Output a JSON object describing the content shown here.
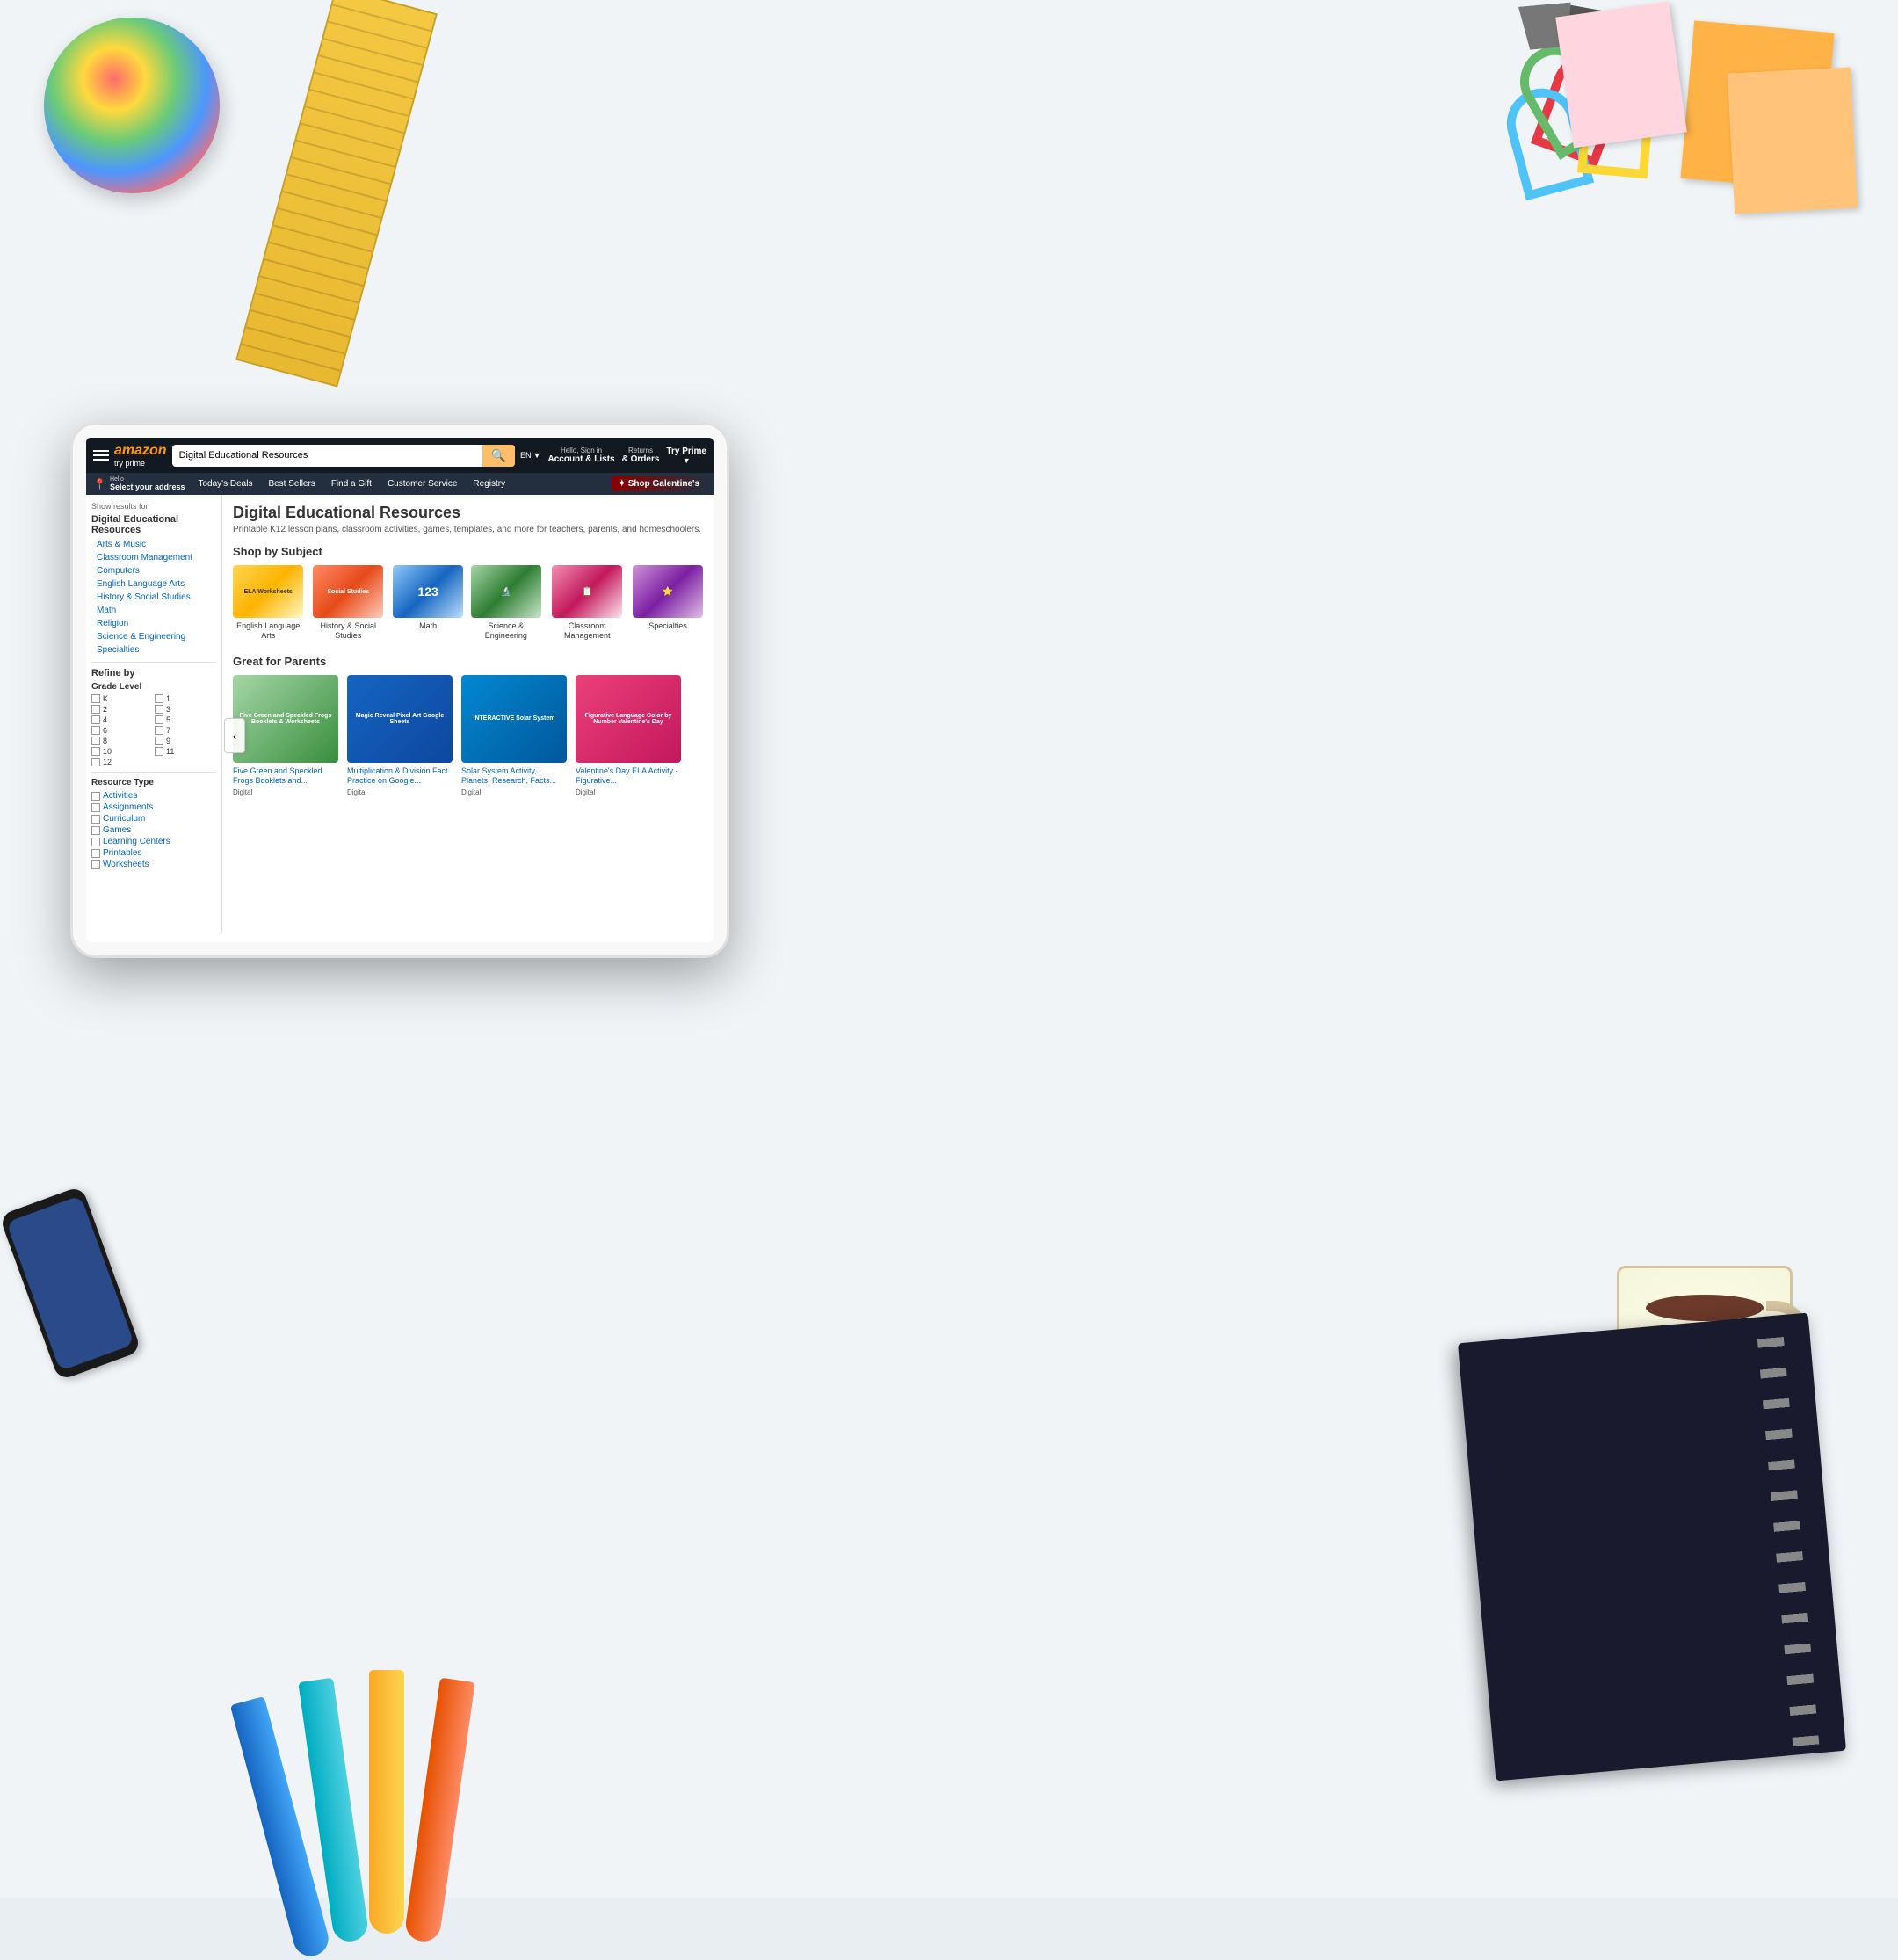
{
  "scene": {
    "background_color": "#e8eef2"
  },
  "amazon": {
    "logo": "amazon",
    "logo_sub": "try prime",
    "search_placeholder": "Digital Educational Resources",
    "search_value": "Digital Educational Resources",
    "nav": {
      "language": "EN",
      "hello": "Hello, Sign in",
      "account_lists": "Account & Lists",
      "returns": "Returns",
      "orders": "& Orders",
      "try_prime": "Try Prime"
    },
    "address_bar": {
      "hello": "Hello",
      "select_address": "Select your address"
    },
    "subnav": [
      "Today's Deals",
      "Best Sellers",
      "Find a Gift",
      "Customer Service",
      "Registry"
    ],
    "galentine_promo": "✦ Shop Galentine's",
    "sidebar": {
      "show_results_for": "Show results for",
      "category_header": "Digital Educational Resources",
      "items": [
        "Arts & Music",
        "Classroom Management",
        "Computers",
        "English Language Arts",
        "History & Social Studies",
        "Math",
        "Religion",
        "Science & Engineering",
        "Specialties"
      ],
      "refine_by": "Refine by",
      "grade_level": "Grade Level",
      "grades": [
        "K",
        "1",
        "2",
        "3",
        "4",
        "5",
        "6",
        "7",
        "8",
        "9",
        "10",
        "11",
        "12"
      ],
      "resource_type": "Resource Type",
      "resource_types": [
        "Activities",
        "Assignments",
        "Curriculum",
        "Games",
        "Learning Centers",
        "Printables",
        "Worksheets"
      ]
    },
    "content": {
      "page_title": "Digital Educational Resources",
      "page_subtitle": "Printable K12 lesson plans, classroom activities, games, templates, and more for teachers, parents, and homeschoolers.",
      "shop_by_subject": "Shop by Subject",
      "subjects": [
        {
          "label": "English Language Arts",
          "color_class": "ela-img"
        },
        {
          "label": "History & Social Studies",
          "color_class": "history-img"
        },
        {
          "label": "Math",
          "color_class": "math-img"
        },
        {
          "label": "Science & Engineering",
          "color_class": "science-img"
        },
        {
          "label": "Classroom Management",
          "color_class": "classroom-img"
        },
        {
          "label": "Specialties",
          "color_class": "special-img"
        }
      ],
      "great_for_parents": "Great for Parents",
      "products": [
        {
          "title": "Five Green and Speckled Frogs Booklets and...",
          "badge": "Digital",
          "color_class": "prod1-img",
          "img_text": "Five Green and Speckled Frogs Booklets & Worksheets"
        },
        {
          "title": "Multiplication & Division Fact Practice on Google...",
          "badge": "Digital",
          "color_class": "prod2-img",
          "img_text": "Magic Reveal Pixel Art Google Sheets"
        },
        {
          "title": "Solar System Activity, Planets, Research, Facts...",
          "badge": "Digital",
          "color_class": "prod3-img",
          "img_text": "INTERACTIVE Solar System"
        },
        {
          "title": "Valentine's Day ELA Activity - Figurative...",
          "badge": "Digital",
          "color_class": "prod4-img",
          "img_text": "Figurative Language Color by Number Valentine's Day"
        }
      ],
      "prev_btn_label": "‹"
    }
  }
}
